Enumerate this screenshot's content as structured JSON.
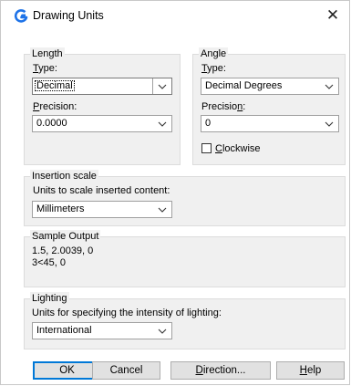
{
  "window": {
    "title": "Drawing Units"
  },
  "length": {
    "legend": "Length",
    "type_label_first": "T",
    "type_label_rest": "ype:",
    "type_value": "Decimal",
    "precision_label_first": "P",
    "precision_label_rest": "recision:",
    "precision_value": "0.0000"
  },
  "angle": {
    "legend": "Angle",
    "type_label_first": "T",
    "type_label_rest": "ype:",
    "type_value": "Decimal Degrees",
    "precision_label_pre": "Precisio",
    "precision_label_u": "n",
    "precision_label_post": ":",
    "precision_value": "0",
    "clockwise_u": "C",
    "clockwise_rest": "lockwise",
    "clockwise_checked": false
  },
  "insertion": {
    "legend": "Insertion scale",
    "label": "Units to scale inserted content:",
    "value": "Millimeters"
  },
  "sample": {
    "legend": "Sample Output",
    "line1": "1.5, 2.0039, 0",
    "line2": "3<45, 0"
  },
  "lighting": {
    "legend": "Lighting",
    "label": "Units for specifying the intensity of lighting:",
    "value": "International"
  },
  "buttons": {
    "ok": "OK",
    "cancel": "Cancel",
    "direction_u": "D",
    "direction_rest": "irection...",
    "help_u": "H",
    "help_rest": "elp"
  },
  "colors": {
    "accent": "#0078d7",
    "panel": "#f0f0f0",
    "icon": "#1e73e8"
  }
}
